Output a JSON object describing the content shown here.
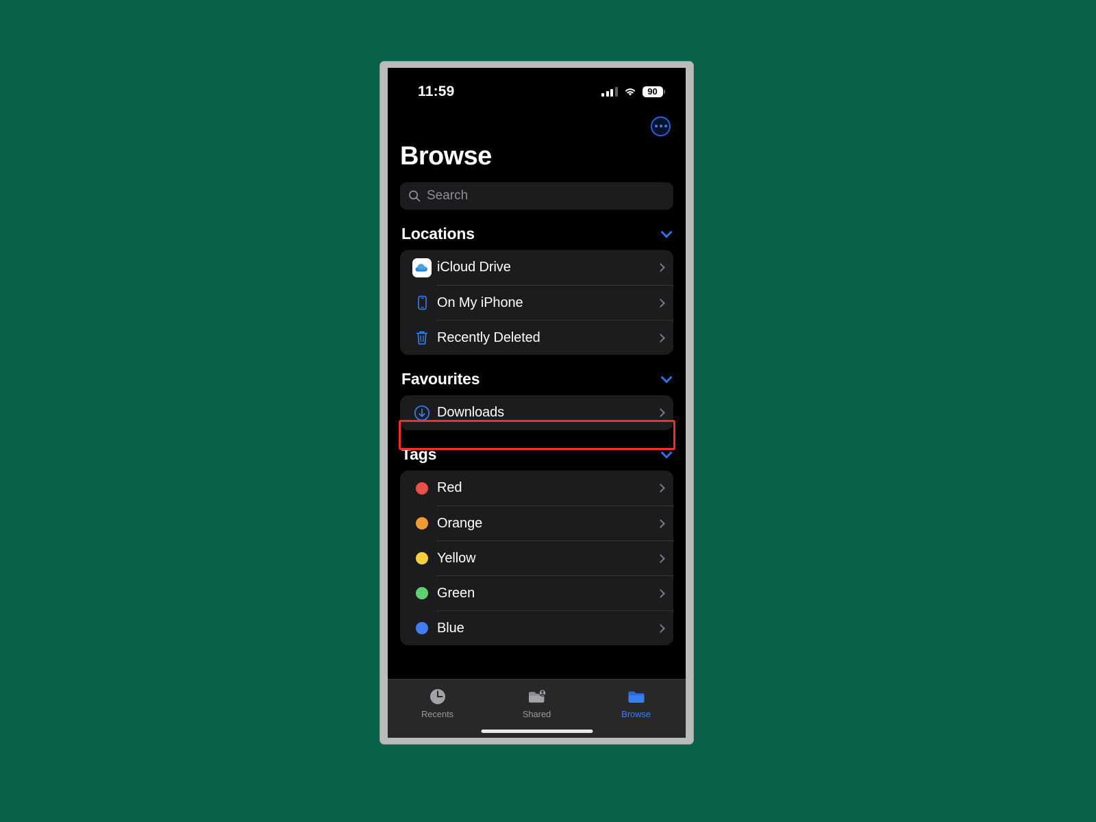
{
  "background_color": "#0a6149",
  "device": {
    "frame_color": "#b9bdb9",
    "screen_color": "#000000"
  },
  "status_bar": {
    "time": "11:59",
    "cellular_icon": "cellular-bars-icon",
    "wifi_icon": "wifi-icon",
    "battery_percent": "90"
  },
  "nav": {
    "more_button_icon": "ellipsis-circle-icon",
    "more_button_label": "More",
    "accent_color": "#3b7ef0"
  },
  "header": {
    "title": "Browse"
  },
  "search": {
    "icon": "search-icon",
    "placeholder": "Search",
    "value": ""
  },
  "sections": [
    {
      "id": "locations",
      "title": "Locations",
      "collapse_icon": "chevron-down-icon",
      "rows": [
        {
          "label": "iCloud Drive",
          "icon": "icloud-drive-icon",
          "accessory": "chevron-right-icon"
        },
        {
          "label": "On My iPhone",
          "icon": "iphone-icon",
          "accessory": "chevron-right-icon"
        },
        {
          "label": "Recently Deleted",
          "icon": "trash-icon",
          "accessory": "chevron-right-icon"
        }
      ]
    },
    {
      "id": "favourites",
      "title": "Favourites",
      "collapse_icon": "chevron-down-icon",
      "rows": [
        {
          "label": "Downloads",
          "icon": "download-circle-icon",
          "accessory": "chevron-right-icon",
          "highlighted": true
        }
      ]
    },
    {
      "id": "tags",
      "title": "Tags",
      "collapse_icon": "chevron-down-icon",
      "rows": [
        {
          "label": "Red",
          "icon": "tag-dot-icon",
          "color": "#e8504a",
          "accessory": "chevron-right-icon"
        },
        {
          "label": "Orange",
          "icon": "tag-dot-icon",
          "color": "#ed9b33",
          "accessory": "chevron-right-icon"
        },
        {
          "label": "Yellow",
          "icon": "tag-dot-icon",
          "color": "#f5d13f",
          "accessory": "chevron-right-icon"
        },
        {
          "label": "Green",
          "icon": "tag-dot-icon",
          "color": "#5fd072",
          "accessory": "chevron-right-icon"
        },
        {
          "label": "Blue",
          "icon": "tag-dot-icon",
          "color": "#3f7ef5",
          "accessory": "chevron-right-icon"
        }
      ]
    }
  ],
  "tab_bar": {
    "items": [
      {
        "label": "Recents",
        "icon": "clock-icon",
        "active": false
      },
      {
        "label": "Shared",
        "icon": "shared-folder-icon",
        "active": false
      },
      {
        "label": "Browse",
        "icon": "folder-icon",
        "active": true
      }
    ]
  },
  "annotation": {
    "highlight_color": "#ef3124",
    "highlight_target": "Downloads"
  }
}
